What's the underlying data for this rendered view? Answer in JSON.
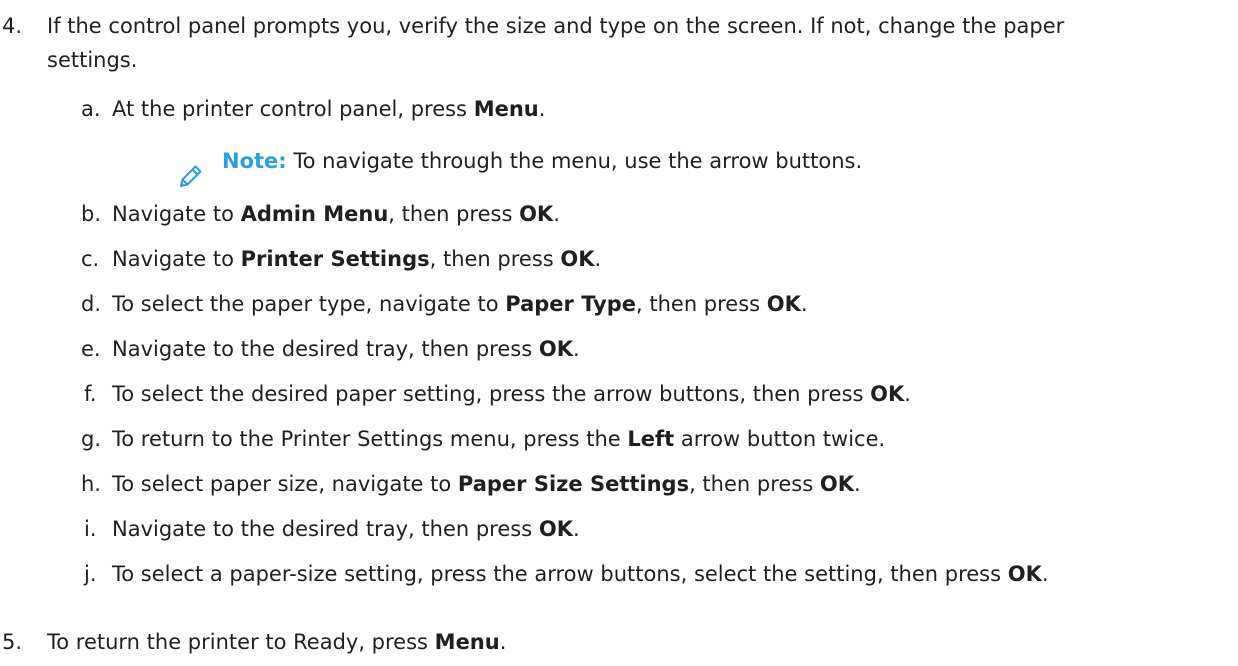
{
  "steps": [
    {
      "number": "4.",
      "text_line1": "If the control panel prompts you, verify the size and type on the screen. If not, change the paper",
      "text_line2": "settings."
    },
    {
      "number": "5.",
      "pre": "To return the printer to Ready, press ",
      "bold": "Menu",
      "post": "."
    }
  ],
  "substeps": [
    {
      "letter": "a.",
      "pre": "At the printer control panel, press ",
      "bold": "Menu",
      "mid": ".",
      "bold2": "",
      "post": ""
    },
    {
      "letter": "b.",
      "pre": "Navigate to ",
      "bold": "Admin Menu",
      "mid": ", then press ",
      "bold2": "OK",
      "post": "."
    },
    {
      "letter": "c.",
      "pre": "Navigate to ",
      "bold": "Printer Settings",
      "mid": ", then press ",
      "bold2": "OK",
      "post": "."
    },
    {
      "letter": "d.",
      "pre": "To select the paper type, navigate to ",
      "bold": "Paper Type",
      "mid": ", then press ",
      "bold2": "OK",
      "post": "."
    },
    {
      "letter": "e.",
      "pre": "Navigate to the desired tray, then press ",
      "bold": "OK",
      "mid": ".",
      "bold2": "",
      "post": ""
    },
    {
      "letter": "f.",
      "pre": "To select the desired paper setting, press the arrow buttons, then press ",
      "bold": "OK",
      "mid": ".",
      "bold2": "",
      "post": ""
    },
    {
      "letter": "g.",
      "pre": "To return to the Printer Settings menu, press the ",
      "bold": "Left",
      "mid": " arrow button twice.",
      "bold2": "",
      "post": ""
    },
    {
      "letter": "h.",
      "pre": "To select paper size, navigate to ",
      "bold": "Paper Size Settings",
      "mid": ", then press ",
      "bold2": "OK",
      "post": "."
    },
    {
      "letter": "i.",
      "pre": "Navigate to the desired tray, then press ",
      "bold": "OK",
      "mid": ".",
      "bold2": "",
      "post": ""
    },
    {
      "letter": "j.",
      "pre": "To select a paper-size setting, press the arrow buttons, select the setting, then press ",
      "bold": "OK",
      "mid": ".",
      "bold2": "",
      "post": ""
    }
  ],
  "note": {
    "label": "Note:",
    "text": " To navigate through the menu, use the arrow buttons.",
    "icon": "pencil-icon",
    "color": "#2a9fd8"
  }
}
